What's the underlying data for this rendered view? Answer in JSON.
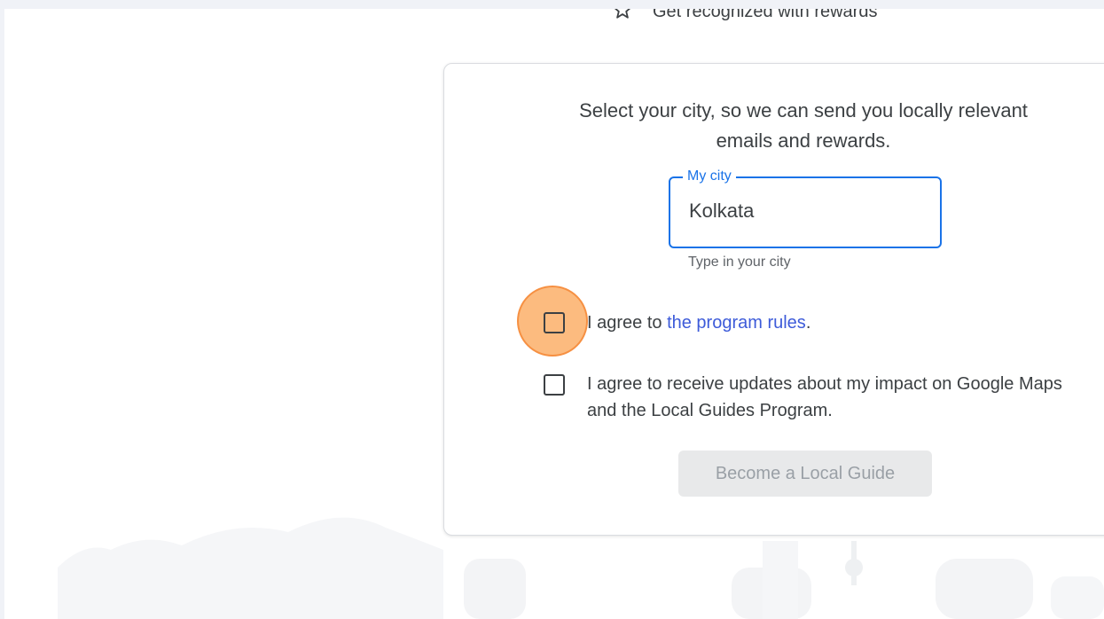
{
  "perk": {
    "icon": "star-outline-icon",
    "text": "Get recognized with rewards"
  },
  "intro": {
    "line1": "Select your city, so we can send you locally relevant",
    "line2": "emails and rewards."
  },
  "city_field": {
    "legend": "My city",
    "value": "Kolkata",
    "helper": "Type in your city"
  },
  "agreements": {
    "rules": {
      "prefix": "I agree to ",
      "link": "the program rules",
      "suffix": ".",
      "checked": false
    },
    "updates": {
      "line1": "I agree to receive updates about my impact on Google Maps",
      "line2": "and the Local Guides Program.",
      "checked": false
    }
  },
  "submit": {
    "label": "Become a Local Guide",
    "disabled": true
  },
  "colors": {
    "accent": "#1a73e8",
    "link": "#3d5bd9",
    "highlight": "#fba454"
  }
}
